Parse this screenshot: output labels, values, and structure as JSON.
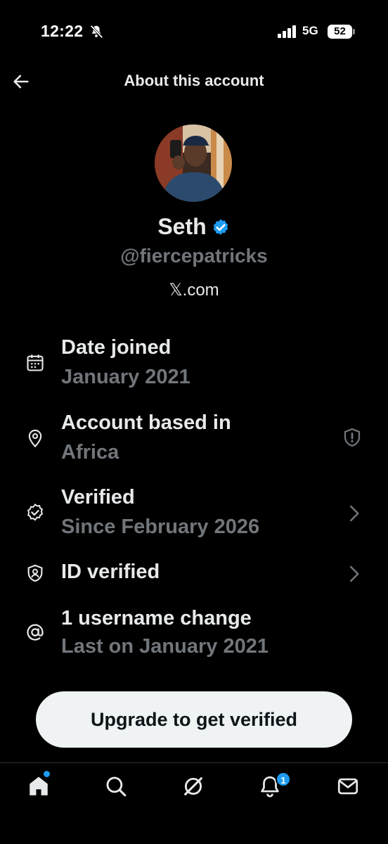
{
  "status_bar": {
    "time": "12:22",
    "network": "5G",
    "battery": "52"
  },
  "header": {
    "title": "About this account",
    "back_icon": "arrow-left-icon"
  },
  "profile": {
    "display_name": "Seth",
    "handle": "@fiercepatricks",
    "site": "𝕏.com",
    "verified_color": "#1d9bf0"
  },
  "rows": [
    {
      "icon": "calendar-icon",
      "title": "Date joined",
      "subtitle": "January 2021"
    },
    {
      "icon": "location-pin-icon",
      "title": "Account based in",
      "subtitle": "Africa",
      "trailing": "shield-info-icon"
    },
    {
      "icon": "verified-check-icon",
      "title": "Verified",
      "subtitle": "Since February 2026",
      "trailing": "chevron-right-icon"
    },
    {
      "icon": "id-shield-icon",
      "title": "ID verified",
      "trailing": "chevron-right-icon"
    },
    {
      "icon": "at-sign-icon",
      "title": "1 username change",
      "subtitle": "Last on January 2021"
    }
  ],
  "cta": {
    "label": "Upgrade to get verified"
  },
  "bottom_nav": {
    "items": [
      "home-icon",
      "search-icon",
      "grok-icon",
      "notifications-icon",
      "messages-icon"
    ],
    "notification_count": "1",
    "accent": "#1d9bf0"
  }
}
